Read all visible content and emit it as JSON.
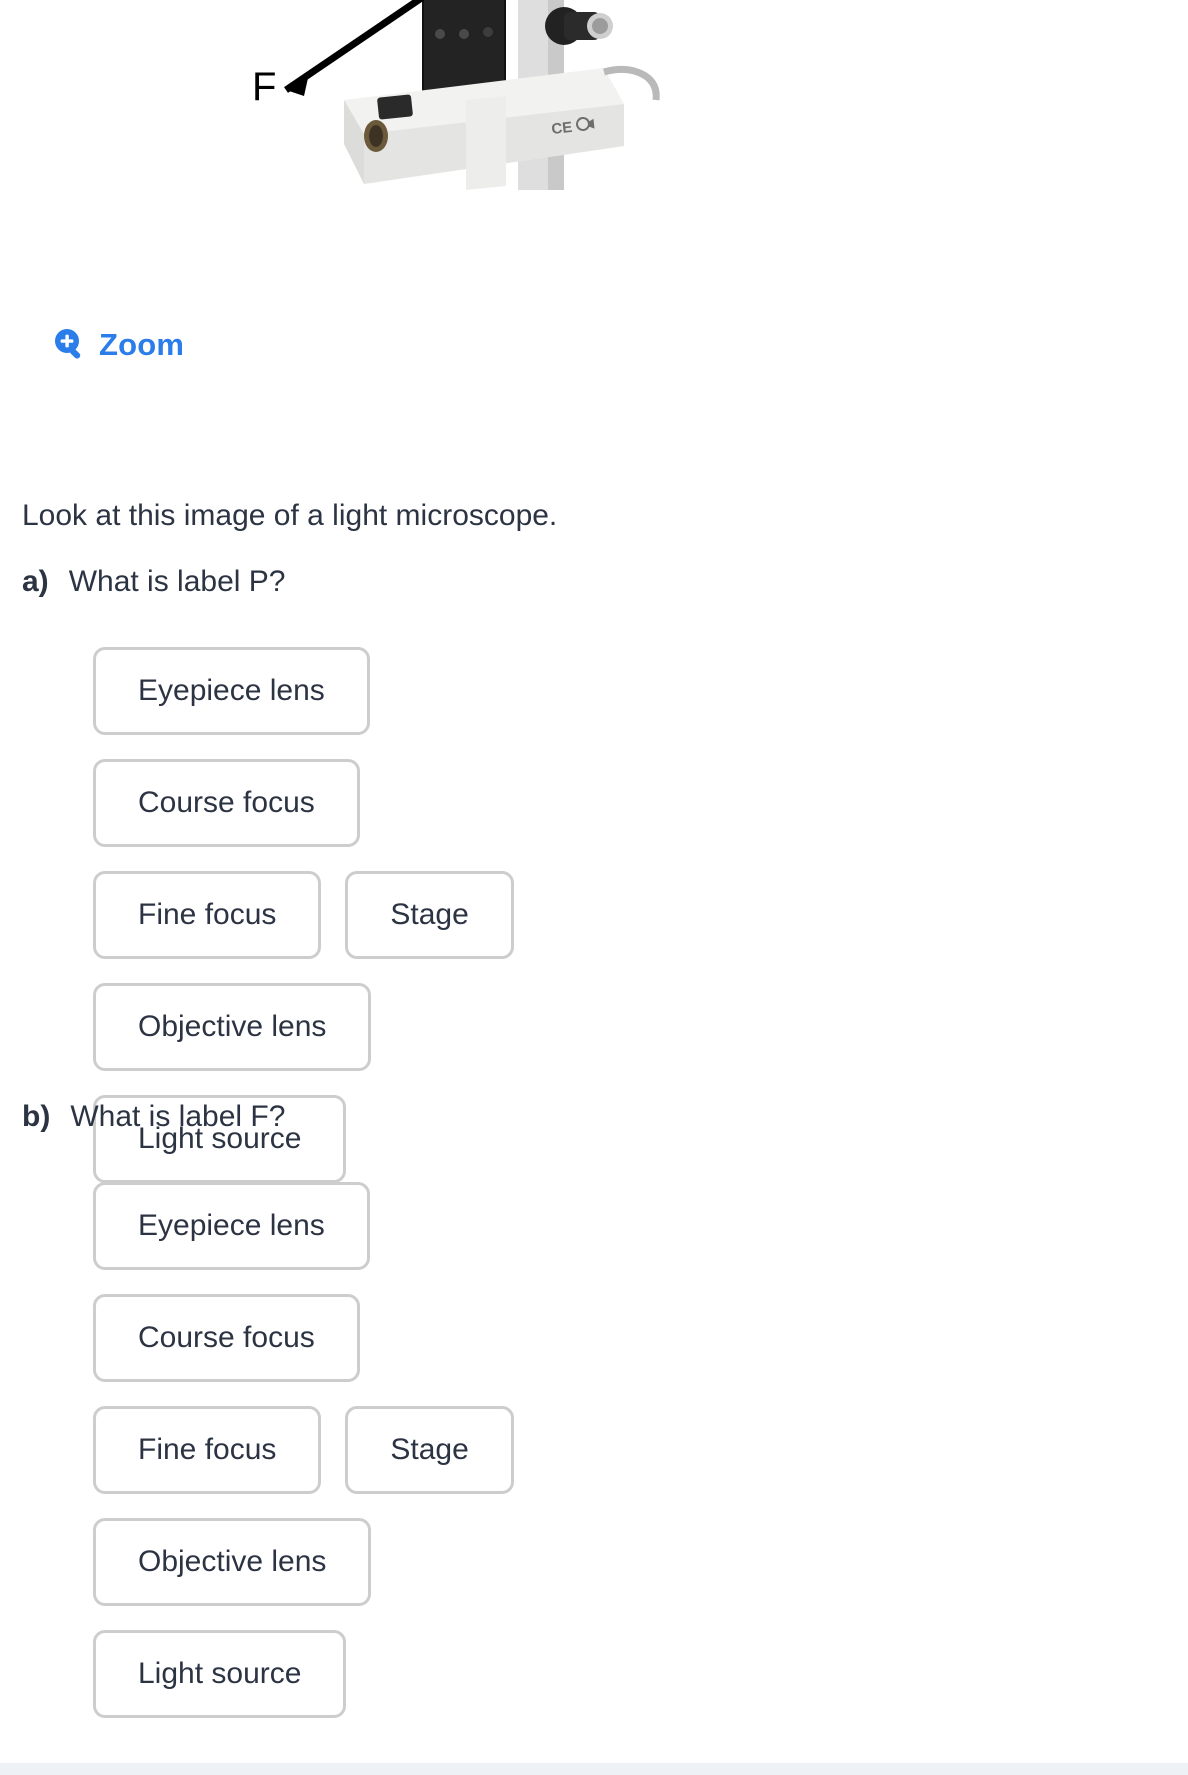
{
  "figure": {
    "alt": "Photograph of a light microscope with labelled parts",
    "label_marker": "F",
    "ce_mark": "CE"
  },
  "zoom": {
    "label": "Zoom",
    "icon": "zoom-in-magnifier-icon",
    "color": "#2b7de9"
  },
  "intro": {
    "text": "Look at this image of a light microscope."
  },
  "questions": [
    {
      "marker": "a)",
      "text": "What is label P?",
      "options": [
        "Eyepiece lens",
        "Course focus",
        "Fine focus",
        "Stage",
        "Objective lens",
        "Light source"
      ]
    },
    {
      "marker": "b)",
      "text": "What is label F?",
      "options": [
        "Eyepiece lens",
        "Course focus",
        "Fine focus",
        "Stage",
        "Objective lens",
        "Light source"
      ]
    }
  ],
  "theme": {
    "text_color": "#2c3444",
    "link_color": "#2b7de9",
    "option_border": "#cdcdcd",
    "background": "#ffffff",
    "bottom_bar": "#eef2f7"
  }
}
